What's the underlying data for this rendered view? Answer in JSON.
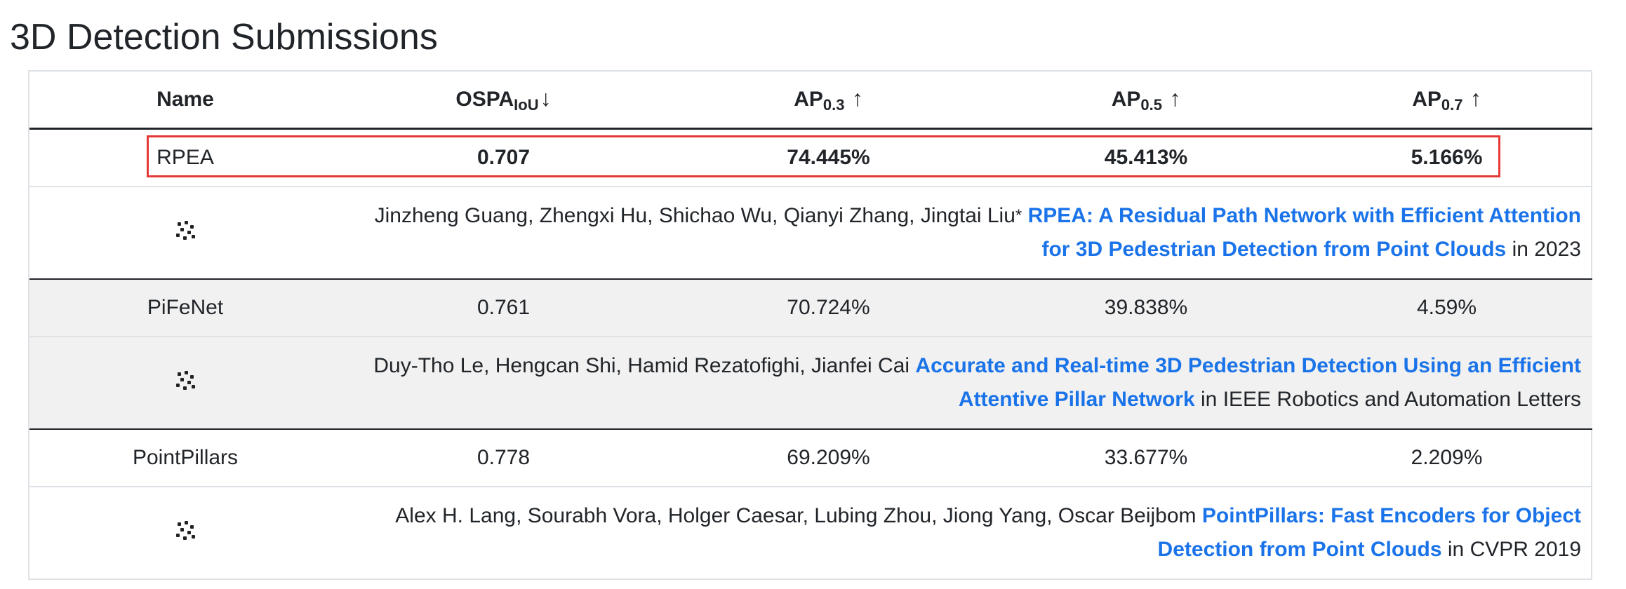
{
  "page": {
    "title": "3D Detection Submissions"
  },
  "table": {
    "headers": {
      "name": "Name",
      "ospa": "OSPA",
      "ospa_sub": "IoU",
      "ospa_arrow": "↓",
      "ap03": "AP",
      "ap03_sub": "0.3",
      "ap05": "AP",
      "ap05_sub": "0.5",
      "ap07": "AP",
      "ap07_sub": "0.7",
      "up_arrow": "↑"
    },
    "rows": [
      {
        "name": "RPEA",
        "ospa": "0.707",
        "ap03": "74.445%",
        "ap05": "45.413%",
        "ap07": "5.166%",
        "authors": "Jinzheng Guang, Zhengxi Hu, Shichao Wu, Qianyi Zhang, Jingtai Liu",
        "author_mark": "*",
        "paper": "RPEA: A Residual Path Network with Efficient Attention for 3D Pedestrian Detection from Point Clouds",
        "venue": "in 2023"
      },
      {
        "name": "PiFeNet",
        "ospa": "0.761",
        "ap03": "70.724%",
        "ap05": "39.838%",
        "ap07": "4.59%",
        "authors": "Duy-Tho Le, Hengcan Shi, Hamid Rezatofighi, Jianfei Cai",
        "paper": "Accurate and Real-time 3D Pedestrian Detection Using an Efficient Attentive Pillar Network",
        "venue": "in IEEE Robotics and Automation Letters"
      },
      {
        "name": "PointPillars",
        "ospa": "0.778",
        "ap03": "69.209%",
        "ap05": "33.677%",
        "ap07": "2.209%",
        "authors": "Alex H. Lang, Sourabh Vora, Holger Caesar, Lubing Zhou, Jiong Yang, Oscar Beijbom",
        "paper": "PointPillars: Fast Encoders for Object Detection from Point Clouds",
        "venue": "in CVPR 2019"
      }
    ]
  },
  "icons": {
    "detail_icon": "point-cloud-icon"
  },
  "colors": {
    "link": "#1a73e8",
    "highlight": "#e53935",
    "shaded_row": "#f1f1f1"
  }
}
